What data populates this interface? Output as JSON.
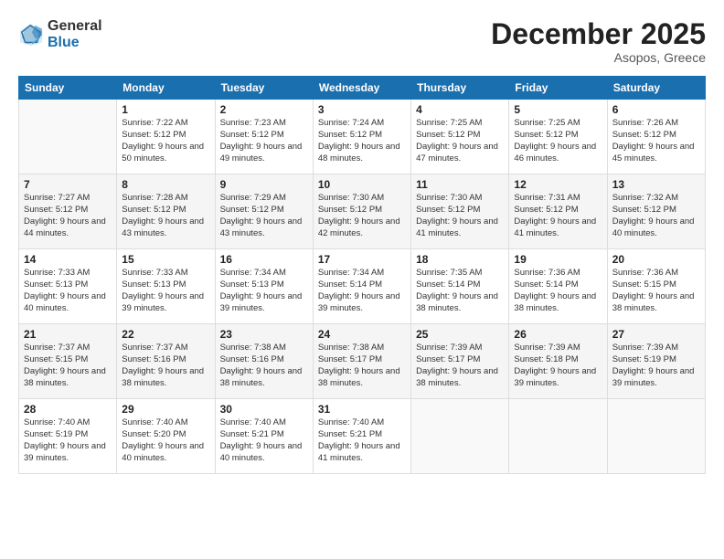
{
  "logo": {
    "general": "General",
    "blue": "Blue"
  },
  "header": {
    "month": "December 2025",
    "location": "Asopos, Greece"
  },
  "days": [
    "Sunday",
    "Monday",
    "Tuesday",
    "Wednesday",
    "Thursday",
    "Friday",
    "Saturday"
  ],
  "weeks": [
    [
      {
        "num": "",
        "sunrise": "",
        "sunset": "",
        "daylight": ""
      },
      {
        "num": "1",
        "sunrise": "Sunrise: 7:22 AM",
        "sunset": "Sunset: 5:12 PM",
        "daylight": "Daylight: 9 hours and 50 minutes."
      },
      {
        "num": "2",
        "sunrise": "Sunrise: 7:23 AM",
        "sunset": "Sunset: 5:12 PM",
        "daylight": "Daylight: 9 hours and 49 minutes."
      },
      {
        "num": "3",
        "sunrise": "Sunrise: 7:24 AM",
        "sunset": "Sunset: 5:12 PM",
        "daylight": "Daylight: 9 hours and 48 minutes."
      },
      {
        "num": "4",
        "sunrise": "Sunrise: 7:25 AM",
        "sunset": "Sunset: 5:12 PM",
        "daylight": "Daylight: 9 hours and 47 minutes."
      },
      {
        "num": "5",
        "sunrise": "Sunrise: 7:25 AM",
        "sunset": "Sunset: 5:12 PM",
        "daylight": "Daylight: 9 hours and 46 minutes."
      },
      {
        "num": "6",
        "sunrise": "Sunrise: 7:26 AM",
        "sunset": "Sunset: 5:12 PM",
        "daylight": "Daylight: 9 hours and 45 minutes."
      }
    ],
    [
      {
        "num": "7",
        "sunrise": "Sunrise: 7:27 AM",
        "sunset": "Sunset: 5:12 PM",
        "daylight": "Daylight: 9 hours and 44 minutes."
      },
      {
        "num": "8",
        "sunrise": "Sunrise: 7:28 AM",
        "sunset": "Sunset: 5:12 PM",
        "daylight": "Daylight: 9 hours and 43 minutes."
      },
      {
        "num": "9",
        "sunrise": "Sunrise: 7:29 AM",
        "sunset": "Sunset: 5:12 PM",
        "daylight": "Daylight: 9 hours and 43 minutes."
      },
      {
        "num": "10",
        "sunrise": "Sunrise: 7:30 AM",
        "sunset": "Sunset: 5:12 PM",
        "daylight": "Daylight: 9 hours and 42 minutes."
      },
      {
        "num": "11",
        "sunrise": "Sunrise: 7:30 AM",
        "sunset": "Sunset: 5:12 PM",
        "daylight": "Daylight: 9 hours and 41 minutes."
      },
      {
        "num": "12",
        "sunrise": "Sunrise: 7:31 AM",
        "sunset": "Sunset: 5:12 PM",
        "daylight": "Daylight: 9 hours and 41 minutes."
      },
      {
        "num": "13",
        "sunrise": "Sunrise: 7:32 AM",
        "sunset": "Sunset: 5:12 PM",
        "daylight": "Daylight: 9 hours and 40 minutes."
      }
    ],
    [
      {
        "num": "14",
        "sunrise": "Sunrise: 7:33 AM",
        "sunset": "Sunset: 5:13 PM",
        "daylight": "Daylight: 9 hours and 40 minutes."
      },
      {
        "num": "15",
        "sunrise": "Sunrise: 7:33 AM",
        "sunset": "Sunset: 5:13 PM",
        "daylight": "Daylight: 9 hours and 39 minutes."
      },
      {
        "num": "16",
        "sunrise": "Sunrise: 7:34 AM",
        "sunset": "Sunset: 5:13 PM",
        "daylight": "Daylight: 9 hours and 39 minutes."
      },
      {
        "num": "17",
        "sunrise": "Sunrise: 7:34 AM",
        "sunset": "Sunset: 5:14 PM",
        "daylight": "Daylight: 9 hours and 39 minutes."
      },
      {
        "num": "18",
        "sunrise": "Sunrise: 7:35 AM",
        "sunset": "Sunset: 5:14 PM",
        "daylight": "Daylight: 9 hours and 38 minutes."
      },
      {
        "num": "19",
        "sunrise": "Sunrise: 7:36 AM",
        "sunset": "Sunset: 5:14 PM",
        "daylight": "Daylight: 9 hours and 38 minutes."
      },
      {
        "num": "20",
        "sunrise": "Sunrise: 7:36 AM",
        "sunset": "Sunset: 5:15 PM",
        "daylight": "Daylight: 9 hours and 38 minutes."
      }
    ],
    [
      {
        "num": "21",
        "sunrise": "Sunrise: 7:37 AM",
        "sunset": "Sunset: 5:15 PM",
        "daylight": "Daylight: 9 hours and 38 minutes."
      },
      {
        "num": "22",
        "sunrise": "Sunrise: 7:37 AM",
        "sunset": "Sunset: 5:16 PM",
        "daylight": "Daylight: 9 hours and 38 minutes."
      },
      {
        "num": "23",
        "sunrise": "Sunrise: 7:38 AM",
        "sunset": "Sunset: 5:16 PM",
        "daylight": "Daylight: 9 hours and 38 minutes."
      },
      {
        "num": "24",
        "sunrise": "Sunrise: 7:38 AM",
        "sunset": "Sunset: 5:17 PM",
        "daylight": "Daylight: 9 hours and 38 minutes."
      },
      {
        "num": "25",
        "sunrise": "Sunrise: 7:39 AM",
        "sunset": "Sunset: 5:17 PM",
        "daylight": "Daylight: 9 hours and 38 minutes."
      },
      {
        "num": "26",
        "sunrise": "Sunrise: 7:39 AM",
        "sunset": "Sunset: 5:18 PM",
        "daylight": "Daylight: 9 hours and 39 minutes."
      },
      {
        "num": "27",
        "sunrise": "Sunrise: 7:39 AM",
        "sunset": "Sunset: 5:19 PM",
        "daylight": "Daylight: 9 hours and 39 minutes."
      }
    ],
    [
      {
        "num": "28",
        "sunrise": "Sunrise: 7:40 AM",
        "sunset": "Sunset: 5:19 PM",
        "daylight": "Daylight: 9 hours and 39 minutes."
      },
      {
        "num": "29",
        "sunrise": "Sunrise: 7:40 AM",
        "sunset": "Sunset: 5:20 PM",
        "daylight": "Daylight: 9 hours and 40 minutes."
      },
      {
        "num": "30",
        "sunrise": "Sunrise: 7:40 AM",
        "sunset": "Sunset: 5:21 PM",
        "daylight": "Daylight: 9 hours and 40 minutes."
      },
      {
        "num": "31",
        "sunrise": "Sunrise: 7:40 AM",
        "sunset": "Sunset: 5:21 PM",
        "daylight": "Daylight: 9 hours and 41 minutes."
      },
      {
        "num": "",
        "sunrise": "",
        "sunset": "",
        "daylight": ""
      },
      {
        "num": "",
        "sunrise": "",
        "sunset": "",
        "daylight": ""
      },
      {
        "num": "",
        "sunrise": "",
        "sunset": "",
        "daylight": ""
      }
    ]
  ]
}
